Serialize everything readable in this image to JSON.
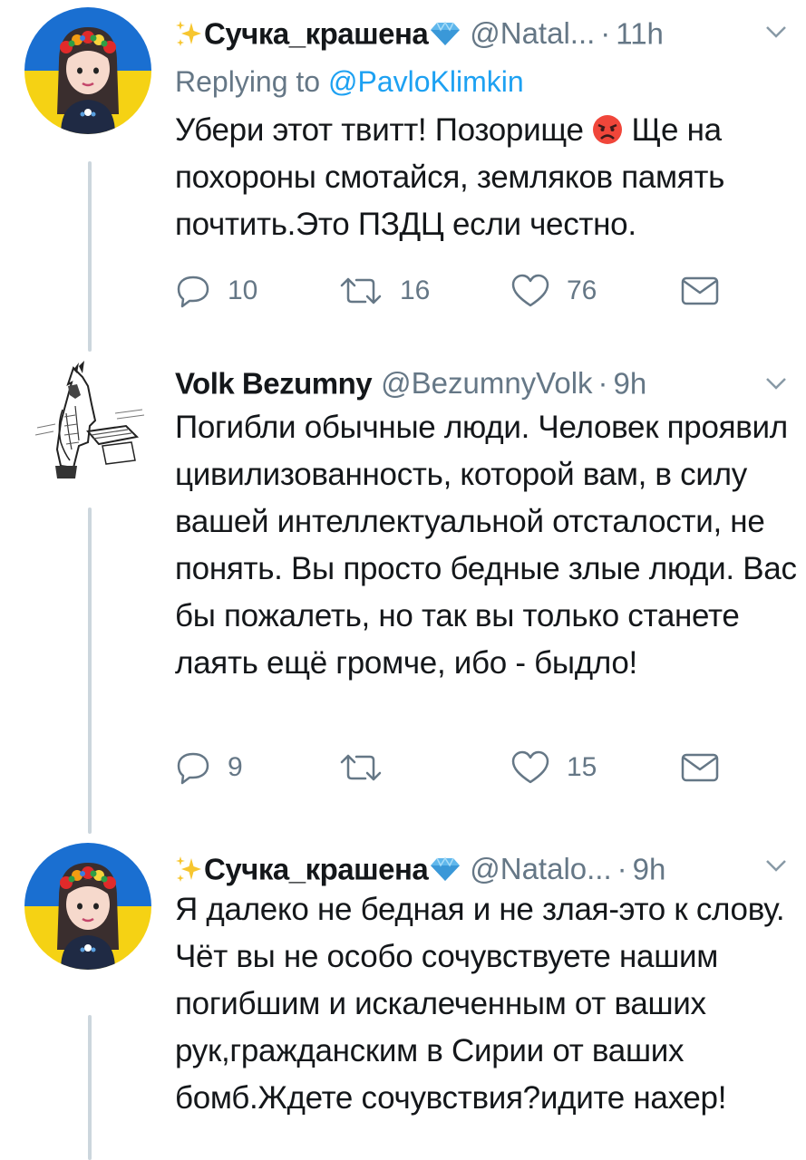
{
  "tweets": [
    {
      "author": "Сучка_крашена",
      "handle": "@Natal...",
      "time": "11h",
      "replying_prefix": "Replying to",
      "replying_to": "@PavloKlimkin",
      "text_part1": "Убери этот твитт! Позорище ",
      "text_part2": " Ще на похороны смотайся, земляков память почтить.Это ПЗДЦ если честно.",
      "emoji": "angry-face",
      "replies": "10",
      "retweets": "16",
      "likes": "76"
    },
    {
      "author": "Volk Bezumny",
      "handle": "@BezumnyVolk",
      "time": "9h",
      "text": "Погибли обычные люди. Человек проявил цивилизованность, которой вам, в силу вашей интеллектуальной отсталости, не понять. Вы просто бедные злые люди. Вас бы пожалеть, но так вы только станете лаять ещё громче, ибо - быдло!",
      "replies": "9",
      "retweets": "",
      "likes": "15"
    },
    {
      "author": "Сучка_крашена",
      "handle": "@Natalo...",
      "time": "9h",
      "text": "Я далеко не бедная и не злая-это к слову. Чёт вы не особо сочувствуете нашим погибшим и искалеченным от ваших рук,гражданским в Сирии от ваших бомб.Ждете сочувствия?идите нахер!"
    }
  ],
  "separator": "·",
  "colors": {
    "text": "#14171a",
    "muted": "#657786",
    "link": "#1da1f2",
    "thread_line": "#ccd6dd",
    "flag_blue": "#1a6fd1",
    "flag_yellow": "#f5d214"
  },
  "icons": [
    "sparkles-icon",
    "gem-icon",
    "chevron-down-icon",
    "reply-icon",
    "retweet-icon",
    "heart-icon",
    "dm-icon"
  ]
}
